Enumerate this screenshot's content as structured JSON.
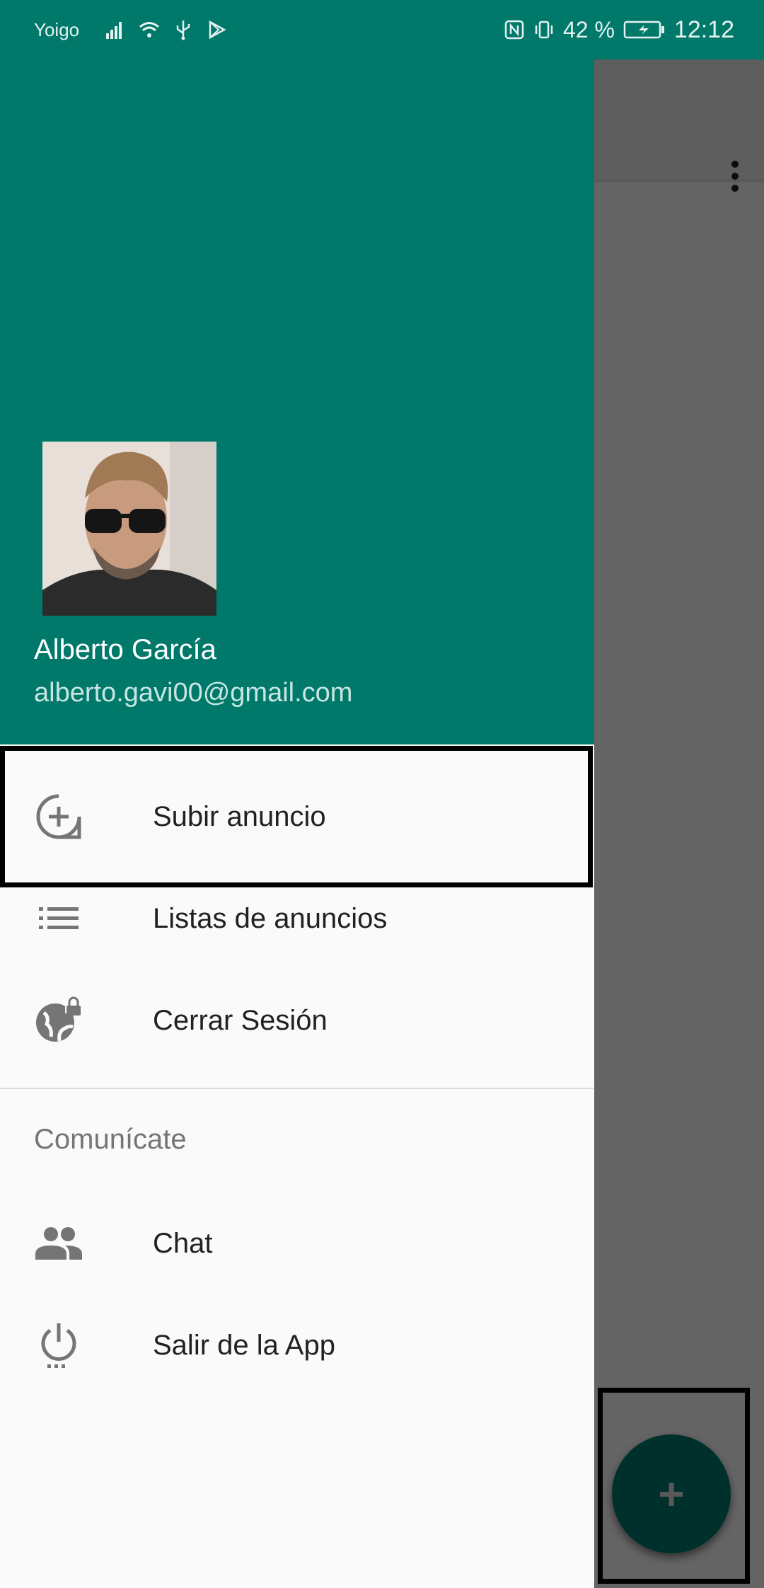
{
  "status_bar": {
    "carrier": "Yoigo",
    "battery_percent": "42 %",
    "time": "12:12",
    "icons": [
      "signal-icon",
      "wifi-icon",
      "usb-icon",
      "play-store-icon",
      "nfc-icon",
      "vibrate-icon",
      "battery-charging-icon"
    ]
  },
  "drawer": {
    "user_name": "Alberto García",
    "user_email": "alberto.gavi00@gmail.com",
    "items": [
      {
        "label": "Subir anuncio",
        "icon": "add-circle-icon"
      },
      {
        "label": "Listas de anuncios",
        "icon": "list-icon"
      },
      {
        "label": "Cerrar Sesión",
        "icon": "globe-lock-icon"
      }
    ],
    "section_title": "Comunícate",
    "section_items": [
      {
        "label": "Chat",
        "icon": "people-icon"
      },
      {
        "label": "Salir de la App",
        "icon": "power-icon"
      }
    ]
  },
  "background": {
    "fab_label": "+",
    "overflow_icon": "more-vert-icon"
  },
  "colors": {
    "primary": "#00796b",
    "scrim": "rgba(0,0,0,0.6)",
    "text_primary": "#212121",
    "text_secondary": "#757575"
  }
}
